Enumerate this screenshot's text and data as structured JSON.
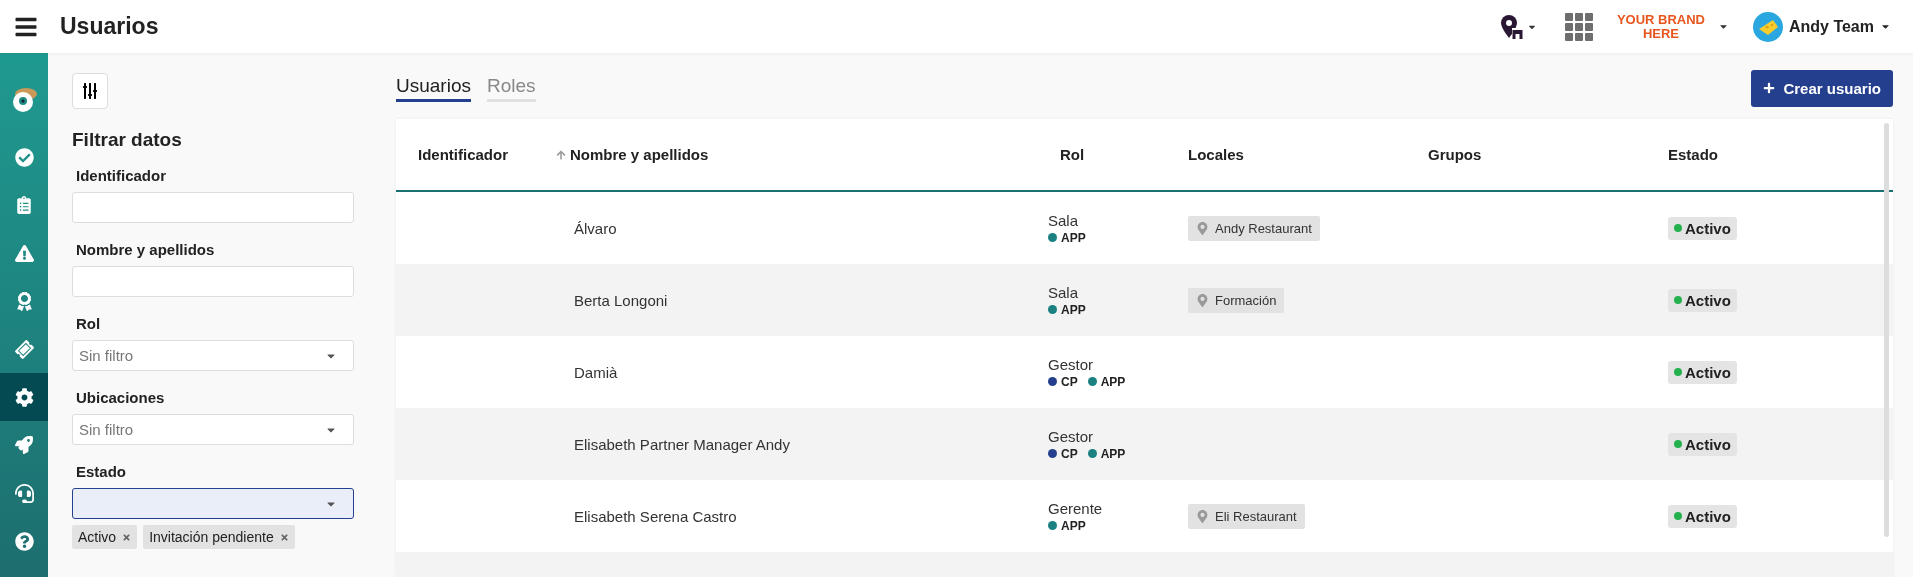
{
  "header": {
    "title": "Usuarios",
    "brand": "YOUR BRAND HERE",
    "account": "Andy Team"
  },
  "sidebar": {
    "items": [
      {
        "kind": "logo",
        "selected": false
      },
      {
        "kind": "check",
        "selected": false
      },
      {
        "kind": "clipboard",
        "selected": false
      },
      {
        "kind": "warning",
        "selected": false
      },
      {
        "kind": "award",
        "selected": false
      },
      {
        "kind": "ticket",
        "selected": false
      },
      {
        "kind": "settings",
        "selected": true
      },
      {
        "kind": "rocket",
        "selected": false
      },
      {
        "kind": "headset",
        "selected": false
      },
      {
        "kind": "help",
        "selected": false
      }
    ]
  },
  "filters": {
    "title": "Filtrar datos",
    "fields": [
      {
        "label": "Identificador",
        "kind": "text",
        "focused": false
      },
      {
        "label": "Nombre y apellidos",
        "kind": "text",
        "focused": false
      },
      {
        "label": "Rol",
        "kind": "select",
        "placeholder": "Sin filtro",
        "focused": false
      },
      {
        "label": "Ubicaciones",
        "kind": "select",
        "placeholder": "Sin filtro",
        "focused": false
      },
      {
        "label": "Estado",
        "kind": "select",
        "focused": true,
        "chips": [
          "Activo",
          "Invitación pendiente"
        ]
      }
    ]
  },
  "tabs": [
    {
      "label": "Usuarios",
      "selected": true
    },
    {
      "label": "Roles",
      "selected": false
    }
  ],
  "create_button": "Crear usuario",
  "table": {
    "columns": [
      {
        "label": "Identificador",
        "sorted": false
      },
      {
        "label": "Nombre y apellidos",
        "sorted": true
      },
      {
        "label": "Rol",
        "sorted": false
      },
      {
        "label": "Locales",
        "sorted": false
      },
      {
        "label": "Grupos",
        "sorted": false
      },
      {
        "label": "Estado",
        "sorted": false
      }
    ],
    "rows": [
      {
        "name": "Álvaro",
        "role": "Sala",
        "apps": [
          {
            "label": "APP",
            "color": "#1a8080"
          }
        ],
        "locations": [
          "Andy Restaurant"
        ],
        "status": {
          "label": "Activo",
          "color": "#22b14c"
        }
      },
      {
        "name": "Berta Longoni",
        "role": "Sala",
        "apps": [
          {
            "label": "APP",
            "color": "#1a8080"
          }
        ],
        "locations": [
          "Formación"
        ],
        "status": {
          "label": "Activo",
          "color": "#22b14c"
        }
      },
      {
        "name": "Damià",
        "role": "Gestor",
        "apps": [
          {
            "label": "CP",
            "color": "#253f8f"
          },
          {
            "label": "APP",
            "color": "#1a8080"
          }
        ],
        "locations": [],
        "status": {
          "label": "Activo",
          "color": "#22b14c"
        }
      },
      {
        "name": "Elisabeth Partner Manager Andy",
        "role": "Gestor",
        "apps": [
          {
            "label": "CP",
            "color": "#253f8f"
          },
          {
            "label": "APP",
            "color": "#1a8080"
          }
        ],
        "locations": [],
        "status": {
          "label": "Activo",
          "color": "#22b14c"
        }
      },
      {
        "name": "Elisabeth Serena Castro",
        "role": "Gerente",
        "apps": [
          {
            "label": "APP",
            "color": "#1a8080"
          }
        ],
        "locations": [
          "Eli Restaurant"
        ],
        "status": {
          "label": "Activo",
          "color": "#22b14c"
        }
      }
    ]
  }
}
